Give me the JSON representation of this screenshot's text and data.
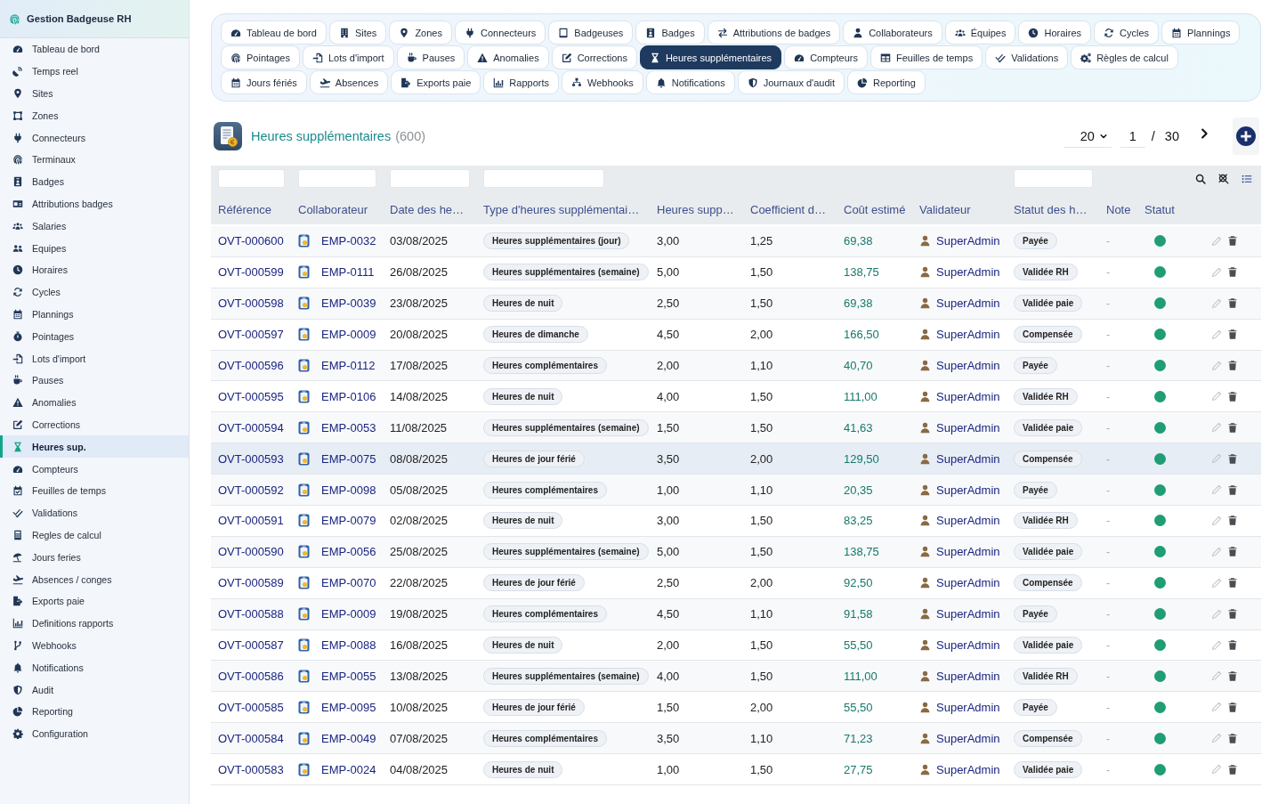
{
  "sidebar": {
    "title": "Gestion Badgeuse RH",
    "items": [
      {
        "label": "Tableau de bord",
        "selected": false
      },
      {
        "label": "Temps reel",
        "selected": false
      },
      {
        "label": "Sites",
        "selected": false
      },
      {
        "label": "Zones",
        "selected": false
      },
      {
        "label": "Connecteurs",
        "selected": false
      },
      {
        "label": "Terminaux",
        "selected": false
      },
      {
        "label": "Badges",
        "selected": false
      },
      {
        "label": "Attributions badges",
        "selected": false
      },
      {
        "label": "Salaries",
        "selected": false
      },
      {
        "label": "Equipes",
        "selected": false
      },
      {
        "label": "Horaires",
        "selected": false
      },
      {
        "label": "Cycles",
        "selected": false
      },
      {
        "label": "Plannings",
        "selected": false
      },
      {
        "label": "Pointages",
        "selected": false
      },
      {
        "label": "Lots d'import",
        "selected": false
      },
      {
        "label": "Pauses",
        "selected": false
      },
      {
        "label": "Anomalies",
        "selected": false
      },
      {
        "label": "Corrections",
        "selected": false
      },
      {
        "label": "Heures sup.",
        "selected": true
      },
      {
        "label": "Compteurs",
        "selected": false
      },
      {
        "label": "Feuilles de temps",
        "selected": false
      },
      {
        "label": "Validations",
        "selected": false
      },
      {
        "label": "Regles de calcul",
        "selected": false
      },
      {
        "label": "Jours feries",
        "selected": false
      },
      {
        "label": "Absences / conges",
        "selected": false
      },
      {
        "label": "Exports paie",
        "selected": false
      },
      {
        "label": "Definitions rapports",
        "selected": false
      },
      {
        "label": "Webhooks",
        "selected": false
      },
      {
        "label": "Notifications",
        "selected": false
      },
      {
        "label": "Audit",
        "selected": false
      },
      {
        "label": "Reporting",
        "selected": false
      },
      {
        "label": "Configuration",
        "selected": false
      }
    ]
  },
  "tab_rows": [
    {
      "tabs": [
        {
          "label": "Tableau de bord",
          "selected": false
        },
        {
          "label": "Sites",
          "selected": false
        },
        {
          "label": "Zones",
          "selected": false
        },
        {
          "label": "Connecteurs",
          "selected": false
        },
        {
          "label": "Badgeuses",
          "selected": false
        },
        {
          "label": "Badges",
          "selected": false
        },
        {
          "label": "Attributions de badges",
          "selected": false
        },
        {
          "label": "Collaborateurs",
          "selected": false
        },
        {
          "label": "Équipes",
          "selected": false
        },
        {
          "label": "Horaires",
          "selected": false
        },
        {
          "label": "Cycles",
          "selected": false
        },
        {
          "label": "Plannings",
          "selected": false
        }
      ]
    },
    {
      "tabs": [
        {
          "label": "Pointages",
          "selected": false
        },
        {
          "label": "Lots d'import",
          "selected": false
        },
        {
          "label": "Pauses",
          "selected": false
        },
        {
          "label": "Anomalies",
          "selected": false
        },
        {
          "label": "Corrections",
          "selected": false
        },
        {
          "label": "Heures supplémentaires",
          "selected": true
        },
        {
          "label": "Compteurs",
          "selected": false
        },
        {
          "label": "Feuilles de temps",
          "selected": false
        },
        {
          "label": "Validations",
          "selected": false
        },
        {
          "label": "Règles de calcul",
          "selected": false
        }
      ]
    },
    {
      "tabs": [
        {
          "label": "Jours fériés",
          "selected": false
        },
        {
          "label": "Absences",
          "selected": false
        },
        {
          "label": "Exports paie",
          "selected": false
        },
        {
          "label": "Rapports",
          "selected": false
        },
        {
          "label": "Webhooks",
          "selected": false
        },
        {
          "label": "Notifications",
          "selected": false
        },
        {
          "label": "Journaux d'audit",
          "selected": false
        },
        {
          "label": "Reporting",
          "selected": false
        }
      ]
    }
  ],
  "page": {
    "title": "Heures supplémentaires",
    "count": "(600)"
  },
  "pagination": {
    "page_size": "20",
    "page": "1",
    "separator": "/",
    "total_pages": "30"
  },
  "table": {
    "columns": [
      {
        "label": "Référence",
        "filterable": true
      },
      {
        "label": "Collaborateur",
        "filterable": true
      },
      {
        "label": "Date des he…",
        "filterable": true
      },
      {
        "label": "Type d'heures supplémentai…",
        "filterable": true
      },
      {
        "label": "Heures supp…",
        "filterable": false
      },
      {
        "label": "Coefficient d…",
        "filterable": false
      },
      {
        "label": "Coût estimé",
        "filterable": false
      },
      {
        "label": "Validateur",
        "filterable": false
      },
      {
        "label": "Statut des h…",
        "filterable": true
      },
      {
        "label": "Note",
        "filterable": false
      },
      {
        "label": "Statut",
        "filterable": false
      }
    ],
    "rows": [
      {
        "reference": "OVT-000600",
        "employee": "EMP-0032",
        "date": "03/08/2025",
        "type": "Heures supplémentaires (jour)",
        "hours": "3,00",
        "coefficient": "1,25",
        "cost": "69,38",
        "validator": "SuperAdmin",
        "status": "Payée",
        "note": "-",
        "active": true,
        "selected": false
      },
      {
        "reference": "OVT-000599",
        "employee": "EMP-0111",
        "date": "26/08/2025",
        "type": "Heures supplémentaires (semaine)",
        "hours": "5,00",
        "coefficient": "1,50",
        "cost": "138,75",
        "validator": "SuperAdmin",
        "status": "Validée RH",
        "note": "-",
        "active": true,
        "selected": false
      },
      {
        "reference": "OVT-000598",
        "employee": "EMP-0039",
        "date": "23/08/2025",
        "type": "Heures de nuit",
        "hours": "2,50",
        "coefficient": "1,50",
        "cost": "69,38",
        "validator": "SuperAdmin",
        "status": "Validée paie",
        "note": "-",
        "active": true,
        "selected": false
      },
      {
        "reference": "OVT-000597",
        "employee": "EMP-0009",
        "date": "20/08/2025",
        "type": "Heures de dimanche",
        "hours": "4,50",
        "coefficient": "2,00",
        "cost": "166,50",
        "validator": "SuperAdmin",
        "status": "Compensée",
        "note": "-",
        "active": true,
        "selected": false
      },
      {
        "reference": "OVT-000596",
        "employee": "EMP-0112",
        "date": "17/08/2025",
        "type": "Heures complémentaires",
        "hours": "2,00",
        "coefficient": "1,10",
        "cost": "40,70",
        "validator": "SuperAdmin",
        "status": "Payée",
        "note": "-",
        "active": true,
        "selected": false
      },
      {
        "reference": "OVT-000595",
        "employee": "EMP-0106",
        "date": "14/08/2025",
        "type": "Heures de nuit",
        "hours": "4,00",
        "coefficient": "1,50",
        "cost": "111,00",
        "validator": "SuperAdmin",
        "status": "Validée RH",
        "note": "-",
        "active": true,
        "selected": false
      },
      {
        "reference": "OVT-000594",
        "employee": "EMP-0053",
        "date": "11/08/2025",
        "type": "Heures supplémentaires (semaine)",
        "hours": "1,50",
        "coefficient": "1,50",
        "cost": "41,63",
        "validator": "SuperAdmin",
        "status": "Validée paie",
        "note": "-",
        "active": true,
        "selected": false
      },
      {
        "reference": "OVT-000593",
        "employee": "EMP-0075",
        "date": "08/08/2025",
        "type": "Heures de jour férié",
        "hours": "3,50",
        "coefficient": "2,00",
        "cost": "129,50",
        "validator": "SuperAdmin",
        "status": "Compensée",
        "note": "-",
        "active": true,
        "selected": true
      },
      {
        "reference": "OVT-000592",
        "employee": "EMP-0098",
        "date": "05/08/2025",
        "type": "Heures complémentaires",
        "hours": "1,00",
        "coefficient": "1,10",
        "cost": "20,35",
        "validator": "SuperAdmin",
        "status": "Payée",
        "note": "-",
        "active": true,
        "selected": false
      },
      {
        "reference": "OVT-000591",
        "employee": "EMP-0079",
        "date": "02/08/2025",
        "type": "Heures de nuit",
        "hours": "3,00",
        "coefficient": "1,50",
        "cost": "83,25",
        "validator": "SuperAdmin",
        "status": "Validée RH",
        "note": "-",
        "active": true,
        "selected": false
      },
      {
        "reference": "OVT-000590",
        "employee": "EMP-0056",
        "date": "25/08/2025",
        "type": "Heures supplémentaires (semaine)",
        "hours": "5,00",
        "coefficient": "1,50",
        "cost": "138,75",
        "validator": "SuperAdmin",
        "status": "Validée paie",
        "note": "-",
        "active": true,
        "selected": false
      },
      {
        "reference": "OVT-000589",
        "employee": "EMP-0070",
        "date": "22/08/2025",
        "type": "Heures de jour férié",
        "hours": "2,50",
        "coefficient": "2,00",
        "cost": "92,50",
        "validator": "SuperAdmin",
        "status": "Compensée",
        "note": "-",
        "active": true,
        "selected": false
      },
      {
        "reference": "OVT-000588",
        "employee": "EMP-0009",
        "date": "19/08/2025",
        "type": "Heures complémentaires",
        "hours": "4,50",
        "coefficient": "1,10",
        "cost": "91,58",
        "validator": "SuperAdmin",
        "status": "Payée",
        "note": "-",
        "active": true,
        "selected": false
      },
      {
        "reference": "OVT-000587",
        "employee": "EMP-0088",
        "date": "16/08/2025",
        "type": "Heures de nuit",
        "hours": "2,00",
        "coefficient": "1,50",
        "cost": "55,50",
        "validator": "SuperAdmin",
        "status": "Validée paie",
        "note": "-",
        "active": true,
        "selected": false
      },
      {
        "reference": "OVT-000586",
        "employee": "EMP-0055",
        "date": "13/08/2025",
        "type": "Heures supplémentaires (semaine)",
        "hours": "4,00",
        "coefficient": "1,50",
        "cost": "111,00",
        "validator": "SuperAdmin",
        "status": "Validée RH",
        "note": "-",
        "active": true,
        "selected": false
      },
      {
        "reference": "OVT-000585",
        "employee": "EMP-0095",
        "date": "10/08/2025",
        "type": "Heures de jour férié",
        "hours": "1,50",
        "coefficient": "2,00",
        "cost": "55,50",
        "validator": "SuperAdmin",
        "status": "Payée",
        "note": "-",
        "active": true,
        "selected": false
      },
      {
        "reference": "OVT-000584",
        "employee": "EMP-0049",
        "date": "07/08/2025",
        "type": "Heures complémentaires",
        "hours": "3,50",
        "coefficient": "1,10",
        "cost": "71,23",
        "validator": "SuperAdmin",
        "status": "Compensée",
        "note": "-",
        "active": true,
        "selected": false
      },
      {
        "reference": "OVT-000583",
        "employee": "EMP-0024",
        "date": "04/08/2025",
        "type": "Heures de nuit",
        "hours": "1,00",
        "coefficient": "1,50",
        "cost": "27,75",
        "validator": "SuperAdmin",
        "status": "Validée paie",
        "note": "-",
        "active": true,
        "selected": false
      }
    ]
  }
}
